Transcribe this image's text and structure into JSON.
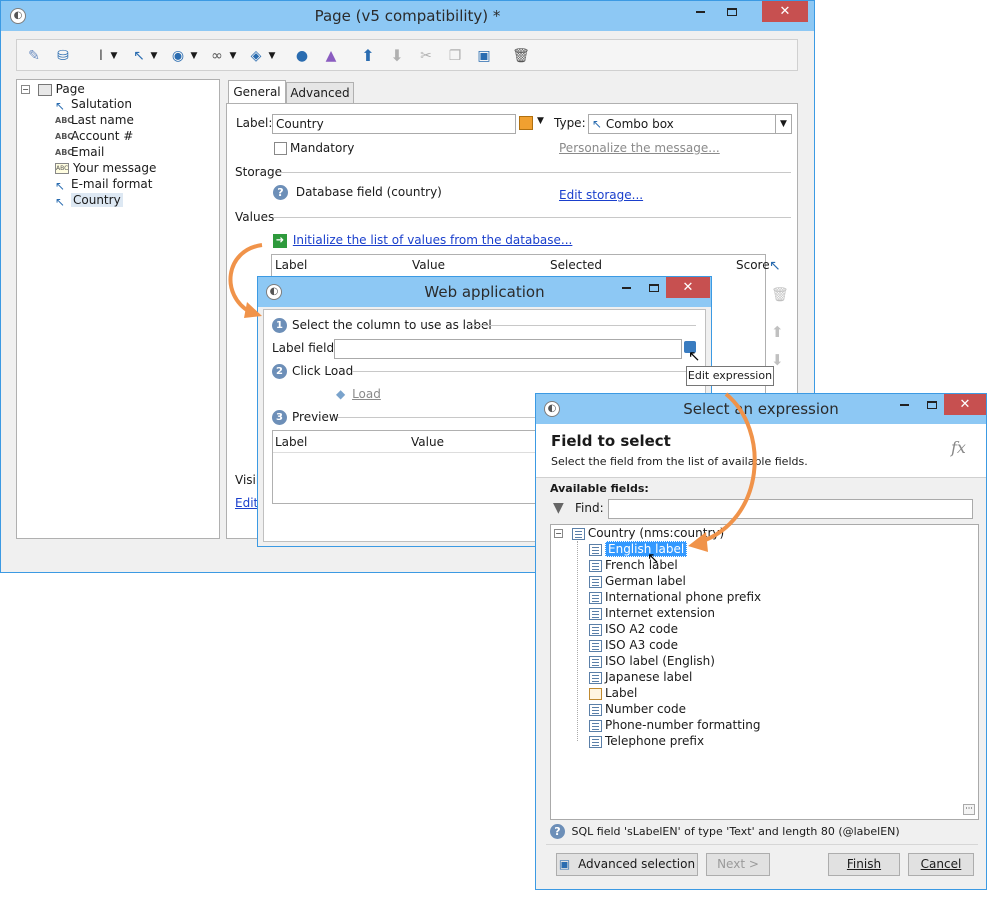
{
  "main_window": {
    "title": "Page (v5 compatibility) *",
    "controls": {
      "min": "—",
      "max": "☐",
      "close": "✕"
    }
  },
  "tree": {
    "root": "Page",
    "items": [
      {
        "label": "Salutation",
        "icon": "cursor-icon"
      },
      {
        "label": "Last name",
        "icon": "abc-icon"
      },
      {
        "label": "Account #",
        "icon": "abc-icon"
      },
      {
        "label": "Email",
        "icon": "abc-icon"
      },
      {
        "label": "Your message",
        "icon": "abc-box-icon"
      },
      {
        "label": "E-mail format",
        "icon": "cursor-icon"
      },
      {
        "label": "Country",
        "icon": "cursor-icon"
      }
    ]
  },
  "tabs": {
    "general": "General",
    "advanced": "Advanced"
  },
  "general": {
    "label_caption": "Label:",
    "label_value": "Country",
    "type_caption": "Type:",
    "type_value": "Combo box",
    "mandatory": "Mandatory",
    "personalize": "Personalize the message...",
    "storage_section": "Storage",
    "storage_field": "Database field (country)",
    "edit_storage": "Edit storage...",
    "values_section": "Values",
    "init_link": "Initialize the list of values from the database...",
    "columns": [
      "Label",
      "Value",
      "Selected",
      "Score"
    ],
    "visibility_partial": "Visib",
    "edit_partial": "Edit"
  },
  "web_app": {
    "title": "Web application",
    "step1": "Select the column to use as label",
    "label_field": "Label field:",
    "tooltip": "Edit expression",
    "step2": "Click Load",
    "load": "Load",
    "step3": "Preview",
    "columns": [
      "Label",
      "Value"
    ],
    "step_numbers": [
      "1",
      "2",
      "3"
    ]
  },
  "expr": {
    "title": "Select an expression",
    "heading": "Field to select",
    "subheading": "Select the field from the list of available fields.",
    "fx": "fx",
    "available": "Available fields:",
    "find": "Find:",
    "root_node": "Country (nms:country)",
    "fields": [
      "English label",
      "French label",
      "German label",
      "International phone prefix",
      "Internet extension",
      "ISO A2 code",
      "ISO A3 code",
      "ISO label (English)",
      "Japanese label",
      "Label",
      "Number code",
      "Phone-number formatting",
      "Telephone prefix"
    ],
    "status": "SQL field 'sLabelEN' of type 'Text' and length 80 (@labelEN)",
    "buttons": {
      "advanced": "Advanced selection",
      "next": "Next >",
      "finish": "Finish",
      "cancel": "Cancel"
    }
  },
  "colors": {
    "title_bar": "#8dc8f4",
    "close": "#c75050",
    "arrow": "#f0934a",
    "selection": "#3399ff"
  }
}
